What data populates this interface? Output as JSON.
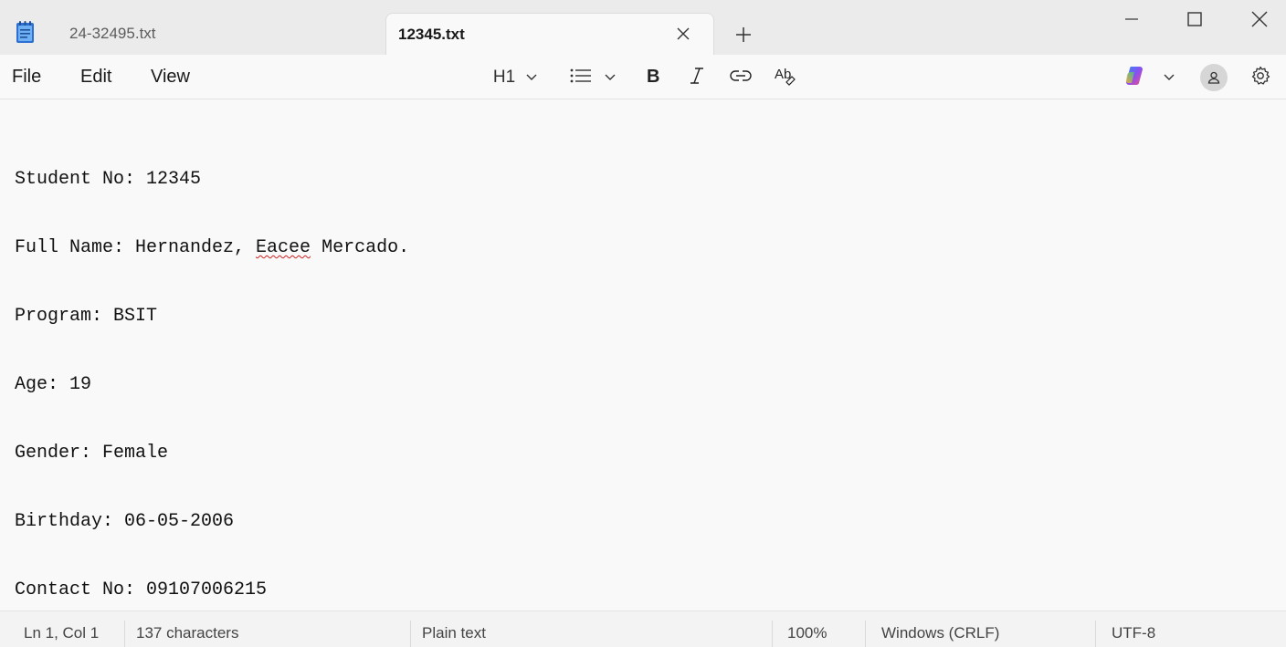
{
  "window": {
    "app_icon": "notepad-icon",
    "minimize_icon": "minimize-icon",
    "maximize_icon": "maximize-icon",
    "close_icon": "close-icon"
  },
  "tabs": [
    {
      "label": "24-32495.txt",
      "active": false
    },
    {
      "label": "12345.txt",
      "active": true
    }
  ],
  "menu": {
    "file": "File",
    "edit": "Edit",
    "view": "View"
  },
  "toolbar": {
    "heading_label": "H1",
    "icons": [
      "list-icon",
      "bold-icon",
      "italic-icon",
      "link-icon",
      "clear-formatting-icon",
      "copilot-icon",
      "account-icon",
      "settings-icon"
    ]
  },
  "document": {
    "lines": [
      "Student No: 12345",
      "Full Name: Hernandez, ",
      "Program: BSIT",
      "Age: 19",
      "Gender: Female",
      "Birthday: 06-05-2006",
      "Contact No: 09107006215"
    ],
    "misspelled_word": "Eacee",
    "name_suffix": " Mercado."
  },
  "status": {
    "position": "Ln 1, Col 1",
    "characters": "137 characters",
    "format": "Plain text",
    "zoom": "100%",
    "line_ending": "Windows (CRLF)",
    "encoding": "UTF-8"
  },
  "colors": {
    "spellcheck_underline": "#d21f1f",
    "titlebar_bg": "#ebebeb",
    "editor_bg": "#f9f9f9"
  }
}
